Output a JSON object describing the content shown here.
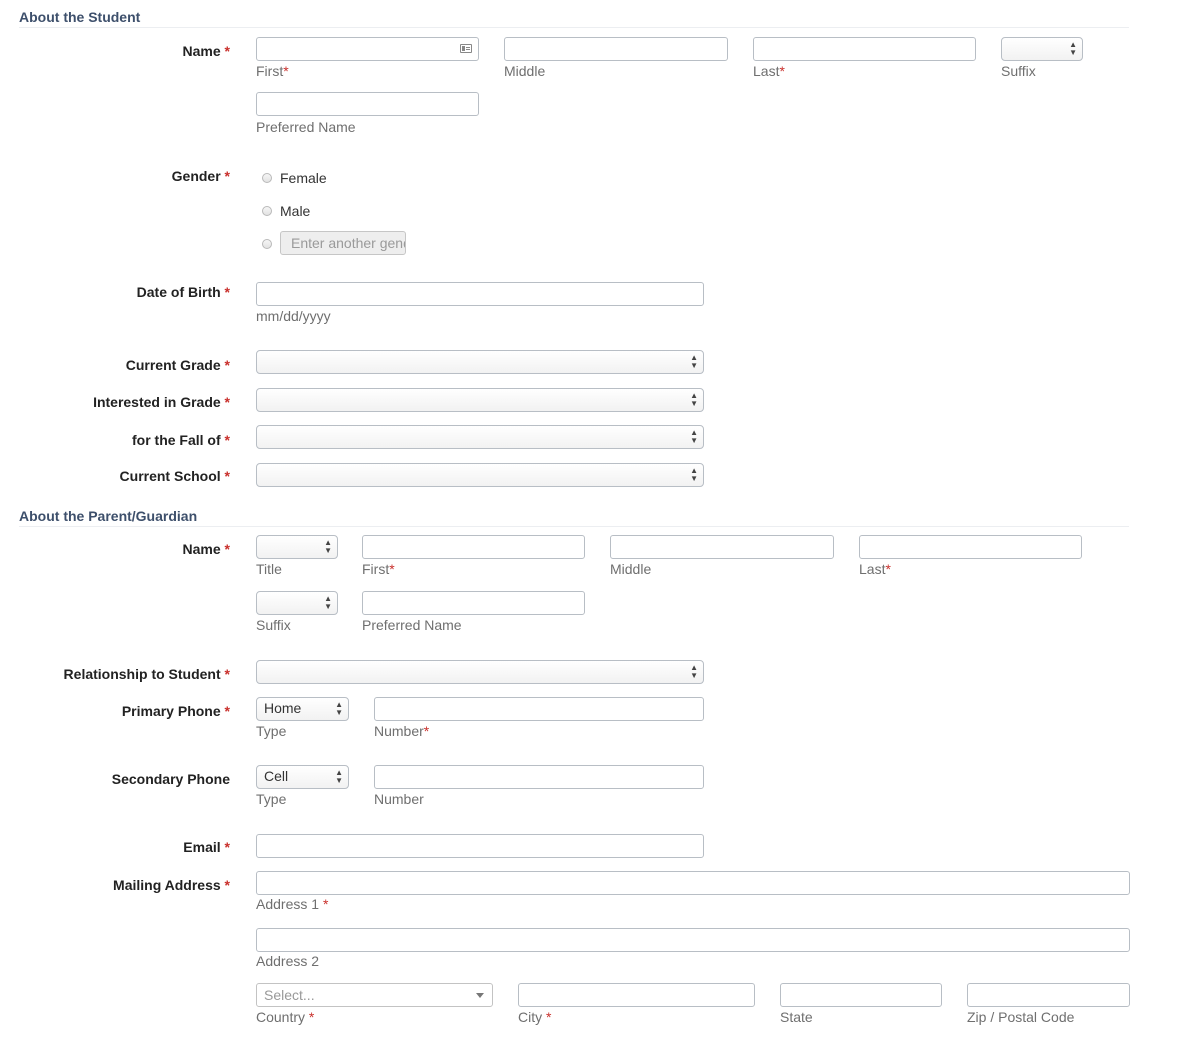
{
  "student": {
    "section_title": "About the Student",
    "name_label": "Name",
    "first_label": "First",
    "middle_label": "Middle",
    "last_label": "Last",
    "suffix_label": "Suffix",
    "preferred_label": "Preferred Name",
    "gender_label": "Gender",
    "gender_options": [
      "Female",
      "Male"
    ],
    "gender_other_placeholder": "Enter another gender",
    "dob_label": "Date of Birth",
    "dob_hint": "mm/dd/yyyy",
    "current_grade_label": "Current Grade",
    "interested_grade_label": "Interested in Grade",
    "fall_of_label": "for the Fall of",
    "current_school_label": "Current School"
  },
  "parent": {
    "section_title": "About the Parent/Guardian",
    "name_label": "Name",
    "title_label": "Title",
    "first_label": "First",
    "middle_label": "Middle",
    "last_label": "Last",
    "suffix_label": "Suffix",
    "preferred_label": "Preferred Name",
    "relationship_label": "Relationship to Student",
    "primary_phone_label": "Primary Phone",
    "primary_phone_type": "Home",
    "type_label": "Type",
    "number_label": "Number",
    "secondary_phone_label": "Secondary Phone",
    "secondary_phone_type": "Cell",
    "email_label": "Email",
    "mailing_label": "Mailing Address",
    "address1_label": "Address 1",
    "address2_label": "Address 2",
    "country_placeholder": "Select...",
    "country_label": "Country",
    "city_label": "City",
    "state_label": "State",
    "zip_label": "Zip / Postal Code"
  },
  "required_marker": "*",
  "colors": {
    "required": "#c9302c",
    "section_title": "#3d4f6b"
  }
}
